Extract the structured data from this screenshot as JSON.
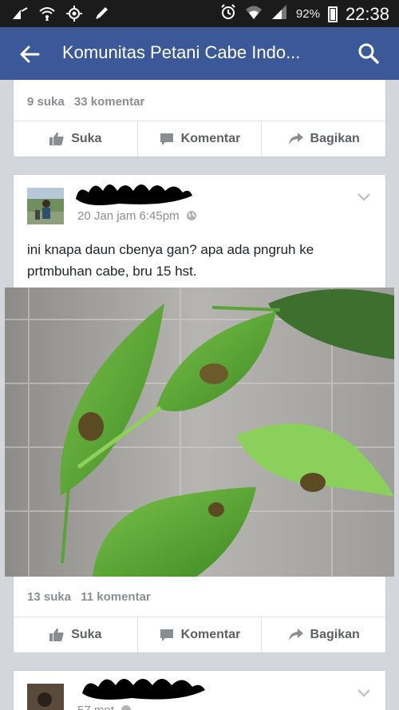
{
  "status_bar": {
    "battery": "92%",
    "time": "22:38"
  },
  "app_bar": {
    "title": "Komunitas Petani Cabe Indo..."
  },
  "post_prev": {
    "likes": "9 suka",
    "comments": "33 komentar",
    "actions": [
      "Suka",
      "Komentar",
      "Bagikan"
    ]
  },
  "post_main": {
    "time": "20 Jan jam 6:45pm",
    "text": "ini knapa daun cbenya gan? apa ada pngruh ke prtmbuhan cabe, bru 15 hst.",
    "likes": "13 suka",
    "comments": "11 komentar",
    "actions": [
      "Suka",
      "Komentar",
      "Bagikan"
    ]
  },
  "post_next": {
    "time": "57 mnt"
  },
  "colors": {
    "brand": "#3b5998",
    "status_bar": "#1b1b1b",
    "background": "#d3d6db"
  }
}
